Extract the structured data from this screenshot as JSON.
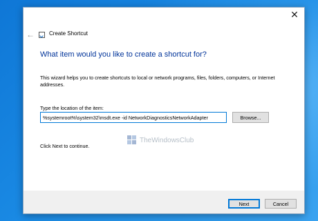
{
  "window": {
    "title": "Create Shortcut",
    "close_glyph": "✕",
    "back_glyph": "←",
    "icon": "shortcut-app-icon"
  },
  "wizard": {
    "heading": "What item would you like to create a shortcut for?",
    "description": "This wizard helps you to create shortcuts to local or network programs, files, folders, computers, or Internet addresses.",
    "location_label": "Type the location of the item:",
    "location_value": "%systemroot%\\system32\\msdt.exe -id NetworkDiagnosticsNetworkAdapter",
    "browse_label": "Browse...",
    "hint": "Click Next to continue."
  },
  "watermark": {
    "text": "TheWindowsClub"
  },
  "footer": {
    "next_label": "Next",
    "cancel_label": "Cancel"
  },
  "colors": {
    "heading": "#003399",
    "accent": "#0078d7",
    "desktop": "#1a8ae4"
  }
}
